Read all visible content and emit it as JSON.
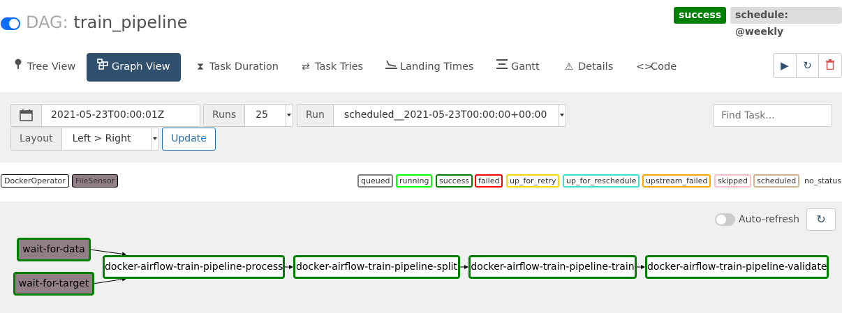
{
  "header": {
    "dag_prefix": "DAG:",
    "dag_id": "train_pipeline",
    "state": "success",
    "schedule": "schedule: @weekly"
  },
  "nav": {
    "tabs": [
      {
        "label": "Tree View",
        "icon": "tree-icon"
      },
      {
        "label": "Graph View",
        "icon": "graph-icon",
        "active": true
      },
      {
        "label": "Task Duration",
        "icon": "hourglass-icon"
      },
      {
        "label": "Task Tries",
        "icon": "repeat-icon"
      },
      {
        "label": "Landing Times",
        "icon": "landing-icon"
      },
      {
        "label": "Gantt",
        "icon": "gantt-icon"
      },
      {
        "label": "Details",
        "icon": "warning-icon"
      },
      {
        "label": "Code",
        "icon": "code-icon"
      }
    ],
    "actions": [
      {
        "icon": "play-icon"
      },
      {
        "icon": "refresh-icon"
      },
      {
        "icon": "trash-icon"
      }
    ]
  },
  "filters": {
    "base_date": "2021-05-23T00:00:01Z",
    "runs_label": "Runs",
    "runs_value": "25",
    "run_label": "Run",
    "run_value": "scheduled__2021-05-23T00:00:00+00:00",
    "layout_label": "Layout",
    "layout_value": "Left > Right",
    "update_label": "Update",
    "find_placeholder": "Find Task..."
  },
  "legend": {
    "operators": [
      {
        "label": "DockerOperator",
        "color": "#ffffff"
      },
      {
        "label": "FileSensor",
        "color": "#917e86"
      }
    ],
    "states": [
      {
        "label": "queued",
        "color": "#808080"
      },
      {
        "label": "running",
        "color": "#00ff00"
      },
      {
        "label": "success",
        "color": "#008000"
      },
      {
        "label": "failed",
        "color": "#ff0000"
      },
      {
        "label": "up_for_retry",
        "color": "#ffd700"
      },
      {
        "label": "up_for_reschedule",
        "color": "#40e0d0"
      },
      {
        "label": "upstream_failed",
        "color": "#ffa500"
      },
      {
        "label": "skipped",
        "color": "#ffc0cb"
      },
      {
        "label": "scheduled",
        "color": "#d2b48c"
      }
    ],
    "no_status": "no_status"
  },
  "graph": {
    "auto_refresh_label": "Auto-refresh",
    "nodes": [
      {
        "id": "wait-for-data",
        "label": "wait-for-data"
      },
      {
        "id": "wait-for-target",
        "label": "wait-for-target"
      },
      {
        "id": "process",
        "label": "docker-airflow-train-pipeline-process"
      },
      {
        "id": "split",
        "label": "docker-airflow-train-pipeline-split"
      },
      {
        "id": "train",
        "label": "docker-airflow-train-pipeline-train"
      },
      {
        "id": "validate",
        "label": "docker-airflow-train-pipeline-validate"
      }
    ]
  }
}
